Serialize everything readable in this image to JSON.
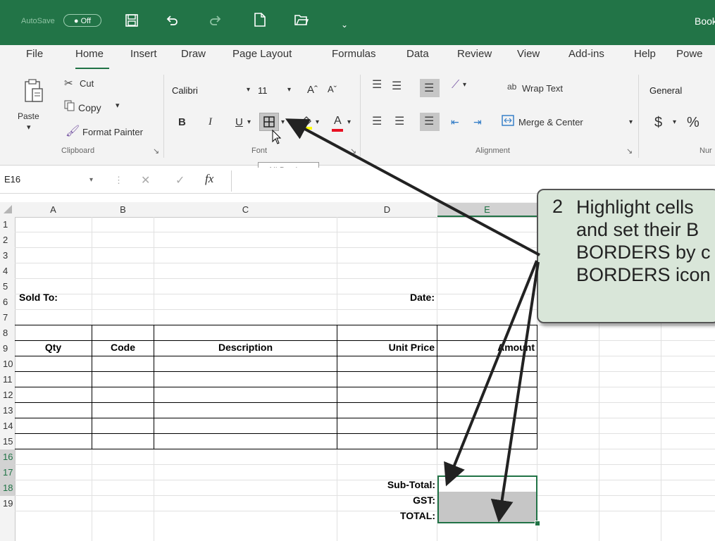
{
  "titlebar": {
    "autosave": "AutoSave",
    "toggle": "● Off",
    "title": "Book",
    "dropdown": "⌄"
  },
  "tabs": [
    "File",
    "Home",
    "Insert",
    "Draw",
    "Page Layout",
    "Formulas",
    "Data",
    "Review",
    "View",
    "Add-ins",
    "Help",
    "Powe"
  ],
  "clipboard": {
    "paste": "Paste",
    "cut": "Cut",
    "copy": "Copy",
    "format_painter": "Format Painter",
    "group": "Clipboard"
  },
  "font": {
    "name": "Calibri",
    "size": "11",
    "grow": "Aˆ",
    "shrink": "Aˇ",
    "bold": "B",
    "italic": "I",
    "underline": "U",
    "group": "Font",
    "font_color_letter": "A"
  },
  "alignment": {
    "wrap": "Wrap Text",
    "merge": "Merge & Center",
    "group": "Alignment",
    "wrap_icon": "ab"
  },
  "number": {
    "format": "General",
    "currency": "$",
    "percent": "%",
    "group": "Nur"
  },
  "tooltip": "All Borders",
  "formula_bar": {
    "name_box": "E16",
    "fx": "fx",
    "cancel": "✕",
    "enter": "✓"
  },
  "columns": [
    "A",
    "B",
    "C",
    "D",
    "E"
  ],
  "rows": [
    "1",
    "2",
    "3",
    "4",
    "5",
    "6",
    "7",
    "8",
    "9",
    "10",
    "11",
    "12",
    "13",
    "14",
    "15",
    "16",
    "17",
    "18",
    "19"
  ],
  "cells": {
    "sold_to": "Sold To:",
    "date": "Date:",
    "qty": "Qty",
    "code": "Code",
    "description": "Description",
    "unit_price": "Unit Price",
    "amount": "Amount",
    "subtotal": "Sub-Total:",
    "gst": "GST:",
    "total": "TOTAL:"
  },
  "callout": {
    "number": "2",
    "text": "Highlight cells\nand set their B\nBORDERS by c\nBORDERS icon"
  },
  "colors": {
    "excel_green": "#217346",
    "title_green": "#227447",
    "selection_gray": "#c6c6c6",
    "callout_bg": "#d9e6d9"
  }
}
